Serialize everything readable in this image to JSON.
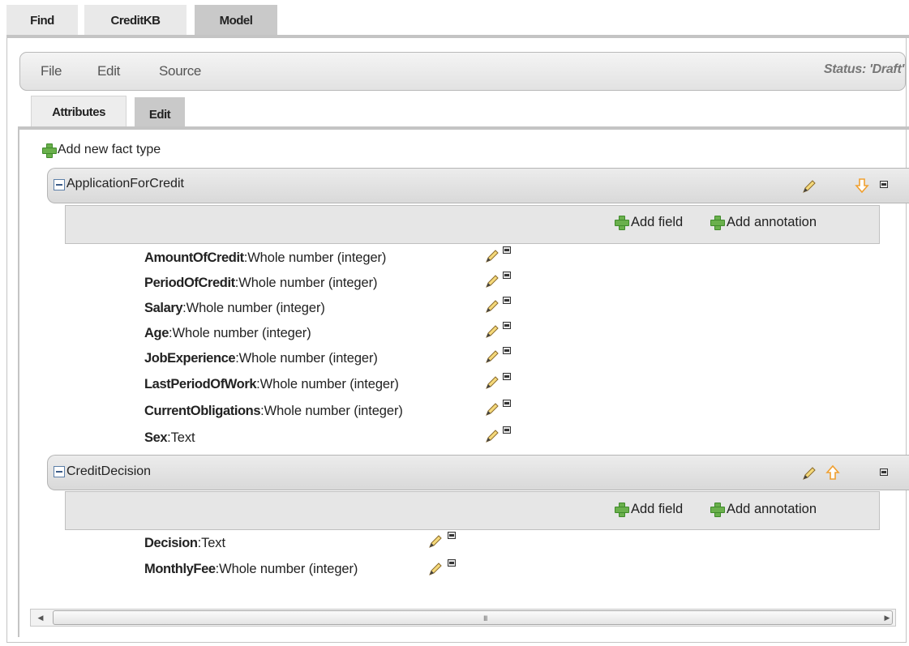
{
  "top_tabs": [
    "Find",
    "CreditKB",
    "Model"
  ],
  "menu": {
    "items": [
      "File",
      "Edit",
      "Source"
    ],
    "status": "Status: 'Draft'"
  },
  "inner_tabs": [
    "Attributes",
    "Edit"
  ],
  "add_new_fact_type": "Add new fact type",
  "add_field_label": "Add field",
  "add_annotation_label": "Add annotation",
  "fact_types": [
    {
      "name": "ApplicationForCredit",
      "fields": [
        {
          "name": "AmountOfCredit",
          "type": "Whole number (integer)"
        },
        {
          "name": "PeriodOfCredit",
          "type": "Whole number (integer)"
        },
        {
          "name": "Salary",
          "type": "Whole number (integer)"
        },
        {
          "name": "Age",
          "type": "Whole number (integer)"
        },
        {
          "name": "JobExperience",
          "type": "Whole number (integer)"
        },
        {
          "name": "LastPeriodOfWork",
          "type": "Whole number (integer)"
        },
        {
          "name": "CurrentObligations",
          "type": "Whole number (integer)"
        },
        {
          "name": "Sex",
          "type": "Text"
        }
      ]
    },
    {
      "name": "CreditDecision",
      "fields": [
        {
          "name": "Decision",
          "type": "Text"
        },
        {
          "name": "MonthlyFee",
          "type": "Whole number (integer)"
        }
      ]
    }
  ],
  "scrollbar_grip": "III",
  "colors": {
    "plus_green": "#6ab04c",
    "arrow_orange": "#f0a030",
    "tab_active": "#c9c9c9"
  },
  "icons": [
    "plus-icon",
    "pencil-icon",
    "arrow-down-icon",
    "arrow-up-icon",
    "minus-icon",
    "collapse-icon"
  ]
}
